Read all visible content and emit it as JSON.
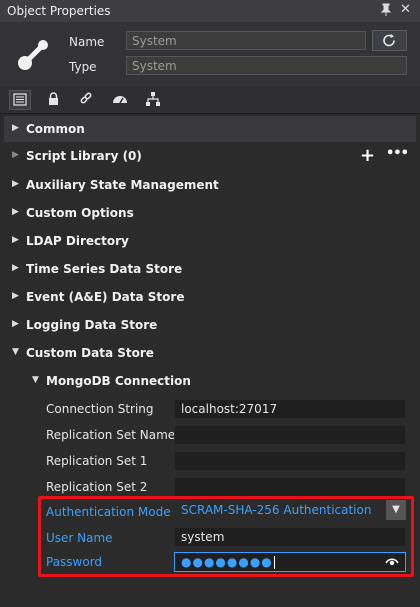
{
  "window": {
    "title": "Object Properties"
  },
  "header": {
    "name_label": "Name",
    "name_value": "System",
    "type_label": "Type",
    "type_value": "System",
    "icon": "connection-node-icon",
    "refresh_icon": "refresh-icon"
  },
  "tabs": [
    "properties-tab-icon",
    "lock-icon",
    "link-icon",
    "gauge-icon",
    "hierarchy-icon"
  ],
  "tree": {
    "common": "Common",
    "script_library": "Script Library (0)",
    "auxiliary": "Auxiliary State Management",
    "custom_options": "Custom Options",
    "ldap": "LDAP Directory",
    "time_series": "Time Series Data Store",
    "event_store": "Event (A&E) Data Store",
    "logging_store": "Logging Data Store",
    "custom_store": "Custom Data Store",
    "mongodb": "MongoDB Connection"
  },
  "properties": {
    "connection_string": {
      "label": "Connection String",
      "value": "localhost:27017"
    },
    "replication_set_name": {
      "label": "Replication Set Name",
      "value": ""
    },
    "replication_set_1": {
      "label": "Replication Set 1",
      "value": ""
    },
    "replication_set_2": {
      "label": "Replication Set 2",
      "value": ""
    },
    "authentication_mode": {
      "label": "Authentication Mode",
      "value": "SCRAM-SHA-256 Authentication"
    },
    "user_name": {
      "label": "User Name",
      "value": "system"
    },
    "password": {
      "label": "Password",
      "value": "●●●●●●●●"
    }
  },
  "colors": {
    "accent": "#3aa0ff",
    "highlight": "#e8131a"
  }
}
